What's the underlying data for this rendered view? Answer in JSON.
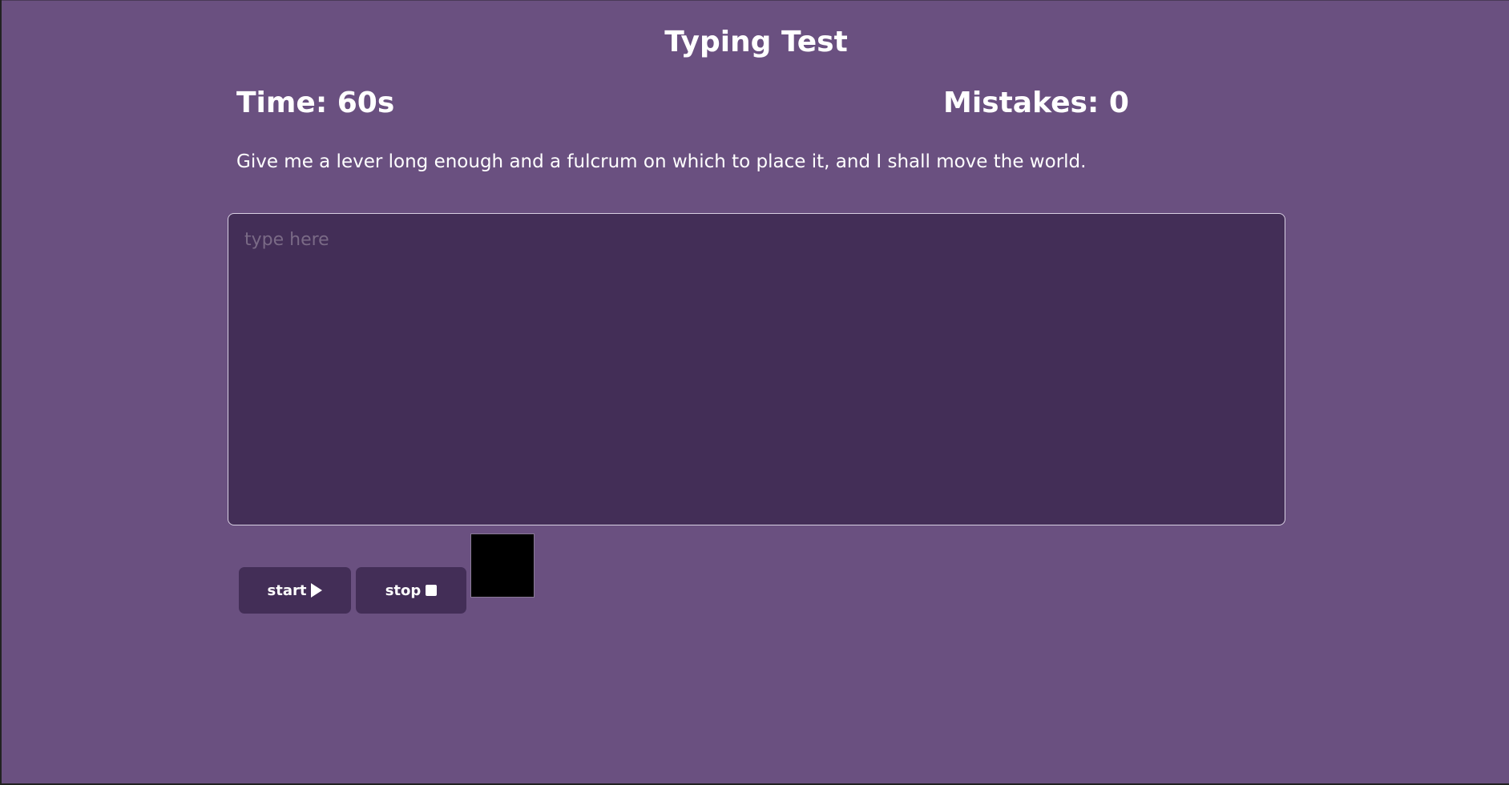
{
  "header": {
    "title": "Typing Test"
  },
  "stats": {
    "time_text": "Time: 60s",
    "mistakes_text": "Mistakes: 0"
  },
  "prompt": {
    "text": "Give me a lever long enough and a fulcrum on which to place it, and I shall move the world."
  },
  "input": {
    "placeholder": "type here",
    "value": ""
  },
  "controls": {
    "start_label": "start",
    "start_icon": "play-icon",
    "stop_label": "stop",
    "stop_icon": "stop-icon"
  },
  "colors": {
    "background": "#6a5080",
    "panel": "#432e57",
    "text": "#ffffff",
    "swatch": "#000000"
  }
}
